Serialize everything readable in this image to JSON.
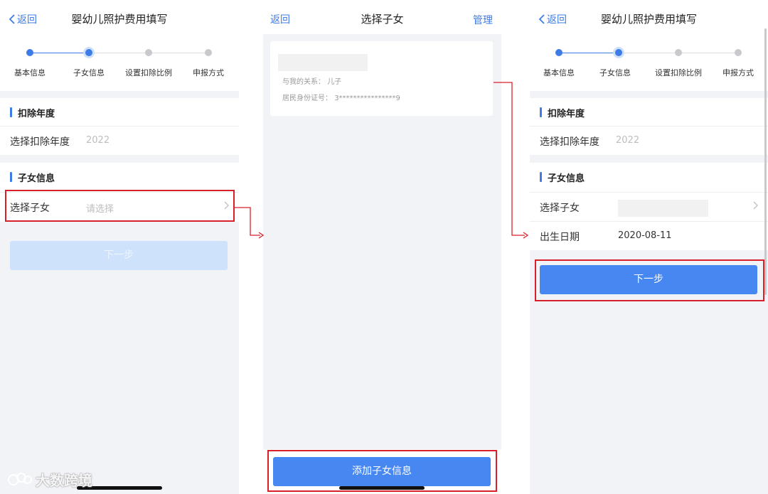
{
  "screens": [
    {
      "back_label": "返回",
      "title": "婴幼儿照护费用填写",
      "steps": [
        "基本信息",
        "子女信息",
        "设置扣除比例",
        "申报方式"
      ],
      "section_year": {
        "title": "扣除年度",
        "row_label": "选择扣除年度",
        "row_value": "2022"
      },
      "section_child": {
        "title": "子女信息",
        "row_label": "选择子女",
        "row_placeholder": "请选择"
      },
      "next_button": "下一步"
    },
    {
      "back_label": "返回",
      "title": "选择子女",
      "manage_label": "管理",
      "child_card": {
        "relation_label": "与我的关系：",
        "relation_value": "儿子",
        "id_label": "居民身份证号：",
        "id_value": "3****************9"
      },
      "add_button": "添加子女信息"
    },
    {
      "back_label": "返回",
      "title": "婴幼儿照护费用填写",
      "steps": [
        "基本信息",
        "子女信息",
        "设置扣除比例",
        "申报方式"
      ],
      "section_year": {
        "title": "扣除年度",
        "row_label": "选择扣除年度",
        "row_value": "2022"
      },
      "section_child": {
        "title": "子女信息",
        "row_label": "选择子女",
        "birth_label": "出生日期",
        "birth_value": "2020-08-11"
      },
      "next_button": "下一步"
    }
  ],
  "watermark": "大数跨境",
  "colors": {
    "accent": "#3d7be6",
    "button_active": "#4787f2",
    "button_disabled": "#cfe2fb",
    "highlight": "#d8202a"
  }
}
